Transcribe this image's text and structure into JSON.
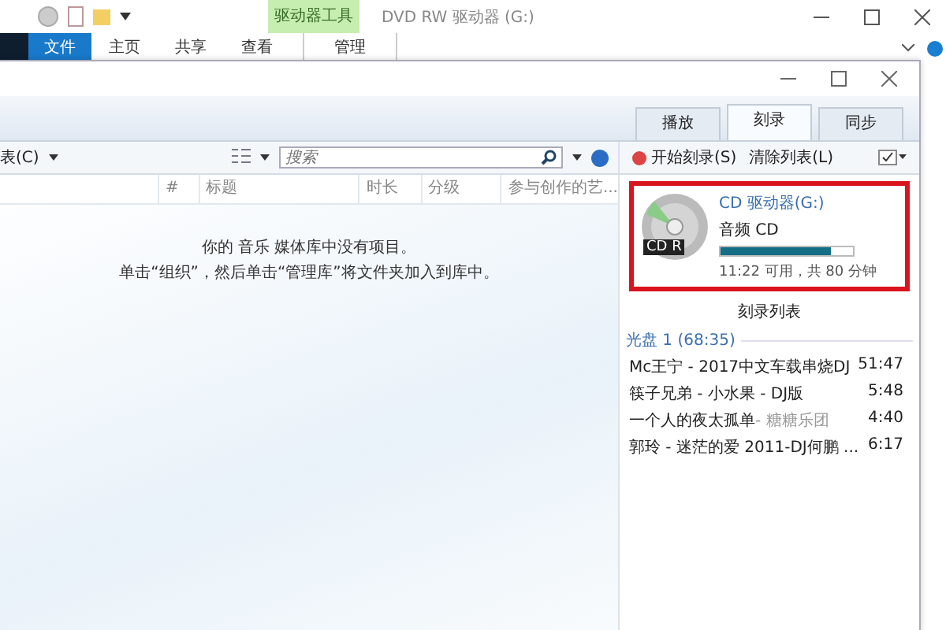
{
  "explorer": {
    "contextual_group": "驱动器工具",
    "title": "DVD RW 驱动器 (G:)",
    "ribbon_tabs": [
      {
        "label": "文件",
        "selected": true
      },
      {
        "label": "主页",
        "selected": false
      },
      {
        "label": "共享",
        "selected": false
      },
      {
        "label": "查看",
        "selected": false
      },
      {
        "label": "管理",
        "selected": false
      }
    ]
  },
  "player": {
    "tabs": [
      {
        "label": "播放",
        "selected": false
      },
      {
        "label": "刻录",
        "selected": true
      },
      {
        "label": "同步",
        "selected": false
      }
    ],
    "toolbar": {
      "organize_cut": "表(C)",
      "search": {
        "placeholder": "搜索"
      },
      "burn_start": "开始刻录(S)",
      "clear_list": "清除列表(L)"
    },
    "columns": [
      "#",
      "标题",
      "时长",
      "分级",
      "参与创作的艺..."
    ],
    "empty_message": [
      "你的 音乐 媒体库中没有项目。",
      "单击“组织”，然后单击“管理库”将文件夹加入到库中。"
    ],
    "cd": {
      "highlighted": true,
      "disc_label": "CD R",
      "drive": "CD 驱动器(G:)",
      "type": "音频 CD",
      "level": 0.83,
      "capacity": "11:22 可用，共 80 分钟"
    },
    "burn_list_title": "刻录列表",
    "disc_header": "光盘 1 (68:35)",
    "tracks": [
      {
        "title": "Mc王宁 - 2017中文车载串烧DJ",
        "duration": "51:47"
      },
      {
        "title": "筷子兄弟 - 小水果 - DJ版",
        "duration": "5:48"
      },
      {
        "title": "一个人的夜太孤单",
        "artist": "- 糖糖乐团",
        "duration": "4:40"
      },
      {
        "title": "郭玲 - 迷茫的爱 2011-DJ何鹏 ...",
        "duration": "6:17"
      }
    ]
  }
}
